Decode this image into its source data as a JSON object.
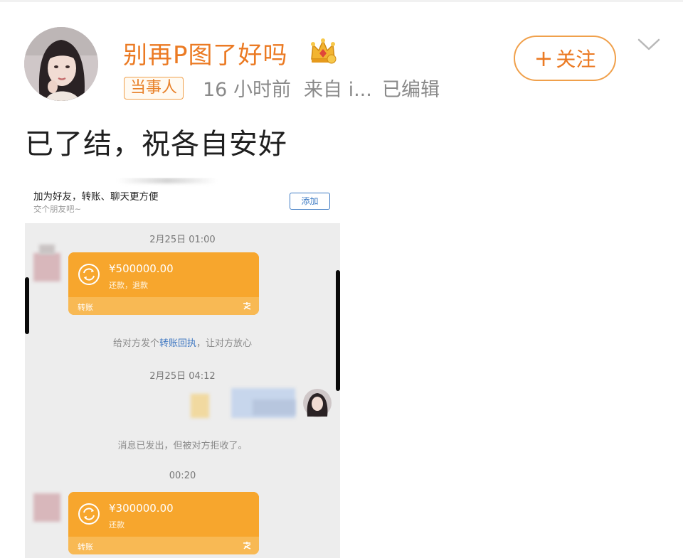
{
  "post": {
    "username": "别再P图了好吗",
    "badge": "当事人",
    "time": "16 小时前",
    "source": "来自 i...",
    "edited": "已编辑",
    "follow_label": "关注",
    "follow_plus": "+",
    "text": "已了结，祝各自安好"
  },
  "screenshot": {
    "header_title": "加为好友，转账、聊天更方便",
    "header_sub": "交个朋友吧~",
    "add_label": "添加",
    "timestamp1": "2月25日 01:00",
    "transfer1": {
      "amount": "¥500000.00",
      "note": "还款，退款",
      "label": "转账"
    },
    "receipt_prefix": "给对方发个",
    "receipt_link": "转账回执",
    "receipt_suffix": "，让对方放心",
    "timestamp2": "2月25日 04:12",
    "rejected_msg": "消息已发出，但被对方拒收了。",
    "timestamp3": "00:20",
    "transfer2": {
      "amount": "¥300000.00",
      "note": "还款",
      "label": "转账"
    }
  },
  "colors": {
    "accent": "#eb7a23",
    "transfer_orange": "#f7a62d",
    "link_blue": "#3d76c1"
  }
}
